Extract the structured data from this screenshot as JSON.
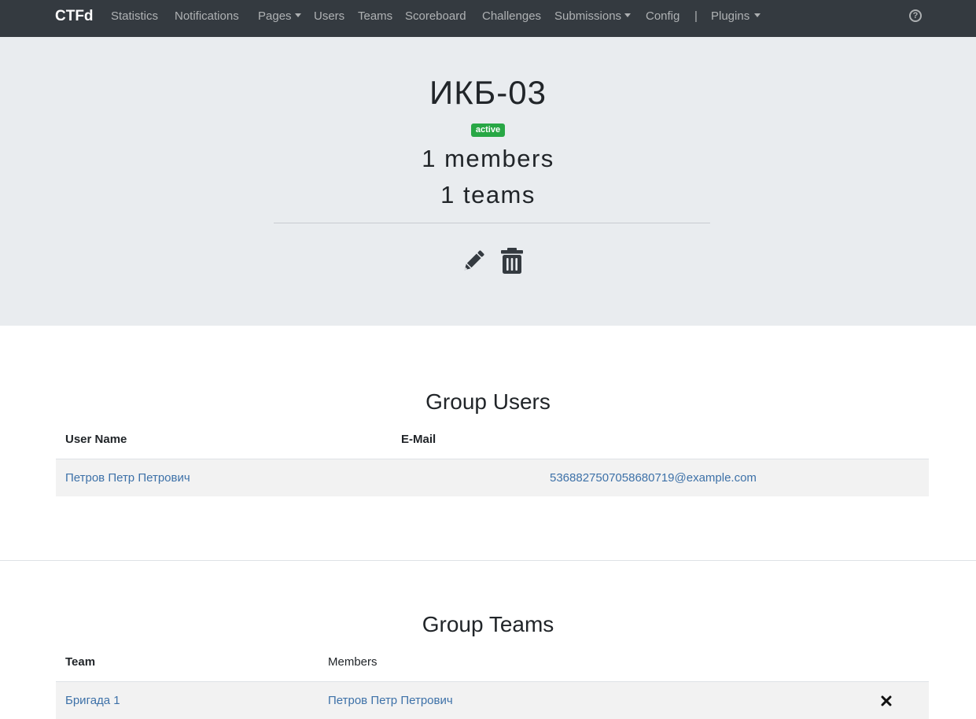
{
  "navbar": {
    "brand": "CTFd",
    "items": [
      {
        "label": "Statistics"
      },
      {
        "label": "Notifications"
      },
      {
        "label": "Pages"
      },
      {
        "label": "Users"
      },
      {
        "label": "Teams"
      },
      {
        "label": "Scoreboard"
      },
      {
        "label": "Challenges"
      },
      {
        "label": "Submissions"
      },
      {
        "label": "Config"
      },
      {
        "label": "Plugins"
      }
    ],
    "separator": "|",
    "help_icon": "question-circle-icon"
  },
  "group": {
    "name": "ИКБ-03",
    "status": "active",
    "members_text": "1 members",
    "teams_text": "1 teams",
    "status_color": "#28a745",
    "actions": [
      {
        "icon": "pencil-icon"
      },
      {
        "icon": "trash-icon"
      }
    ]
  },
  "users_section": {
    "title": "Group Users",
    "columns": [
      "User Name",
      "E-Mail"
    ],
    "rows": [
      {
        "name": "Петров Петр Петрович",
        "email": "536882750705868071­9@example.com"
      }
    ]
  },
  "teams_section": {
    "title": "Group Teams",
    "columns": [
      "Team",
      "Members"
    ],
    "rows": [
      {
        "team": "Бригада 1",
        "members": "Петров Петр Петрович",
        "remove_icon": "times-icon"
      }
    ]
  },
  "colors": {
    "navbar_bg": "#343a40",
    "jumbotron_bg": "#e9ecef",
    "link": "#3d71a8",
    "row_bg": "#f2f2f2"
  }
}
